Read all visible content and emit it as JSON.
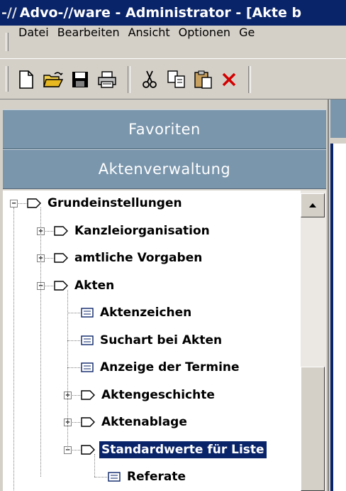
{
  "window": {
    "logo": "-//",
    "title": "Advo-//ware  -  Administrator - [Akte b"
  },
  "menu": [
    {
      "label": "Datei"
    },
    {
      "label": "Bearbeiten"
    },
    {
      "label": "Ansicht"
    },
    {
      "label": "Optionen"
    },
    {
      "label": "Ge"
    }
  ],
  "toolbar": {
    "icons": [
      "new-document-icon",
      "open-folder-icon",
      "save-icon",
      "print-icon",
      "cut-icon",
      "copy-icon",
      "paste-icon",
      "delete-icon"
    ]
  },
  "panels": {
    "favorites_label": "Favoriten",
    "files_label": "Aktenverwaltung"
  },
  "tree": [
    {
      "label": "Grundeinstellungen",
      "level": 0,
      "type": "folder",
      "expander": "minus"
    },
    {
      "label": "Kanzleiorganisation",
      "level": 1,
      "type": "folder",
      "expander": "plus"
    },
    {
      "label": "amtliche Vorgaben",
      "level": 1,
      "type": "folder",
      "expander": "plus"
    },
    {
      "label": "Akten",
      "level": 1,
      "type": "folder",
      "expander": "minus"
    },
    {
      "label": "Aktenzeichen",
      "level": 2,
      "type": "form"
    },
    {
      "label": "Suchart bei Akten",
      "level": 2,
      "type": "form"
    },
    {
      "label": "Anzeige der Termine",
      "level": 2,
      "type": "form"
    },
    {
      "label": "Aktengeschichte",
      "level": 2,
      "type": "folder",
      "expander": "plus"
    },
    {
      "label": "Aktenablage",
      "level": 2,
      "type": "folder",
      "expander": "plus"
    },
    {
      "label": "Standardwerte für Liste",
      "level": 2,
      "type": "folder",
      "expander": "minus",
      "selected": true
    },
    {
      "label": "Referate",
      "level": 3,
      "type": "form"
    }
  ],
  "colors": {
    "titlebar": "#0a246a",
    "panel_header": "#7a96ac",
    "selection": "#0a246a",
    "delete_icon": "#d40000"
  }
}
